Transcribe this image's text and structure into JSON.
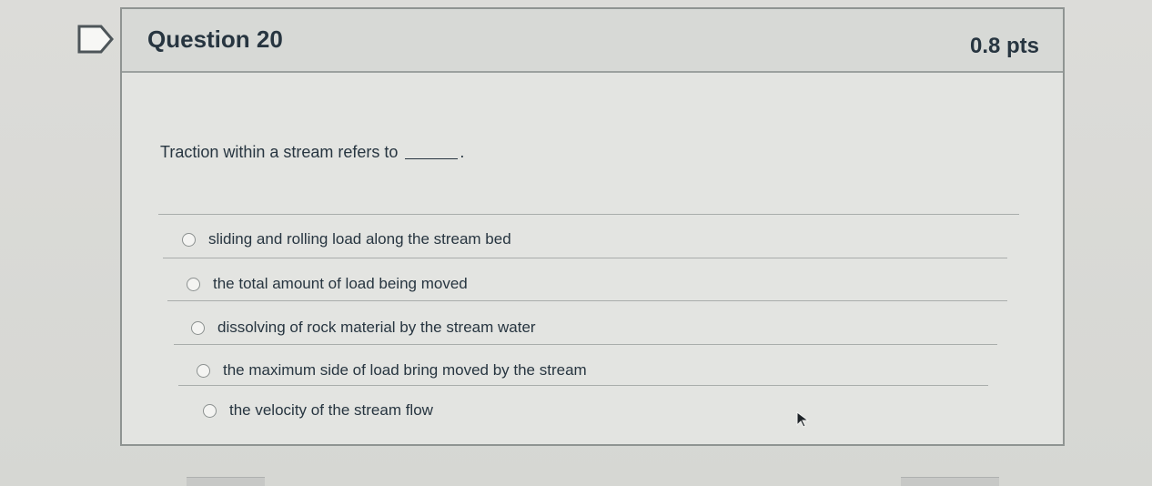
{
  "question": {
    "title": "Question 20",
    "points": "0.8 pts",
    "prompt": "Traction within a stream refers to",
    "prompt_end": "."
  },
  "answers": [
    {
      "label": "sliding and rolling load along the stream bed"
    },
    {
      "label": "the total amount of load being moved"
    },
    {
      "label": "dissolving of rock material by the stream water"
    },
    {
      "label": "the maximum side of load bring moved by the stream"
    },
    {
      "label": "the velocity of the stream flow"
    }
  ],
  "icons": {
    "flag": "flag-icon",
    "cursor": "mouse-pointer-icon",
    "radio": "radio-button-icon"
  },
  "colors": {
    "page_background": "#d9d9d6",
    "card_background": "#e3e4e1",
    "header_background": "#d7d9d6",
    "border": "#8f9492",
    "text": "#273540"
  }
}
